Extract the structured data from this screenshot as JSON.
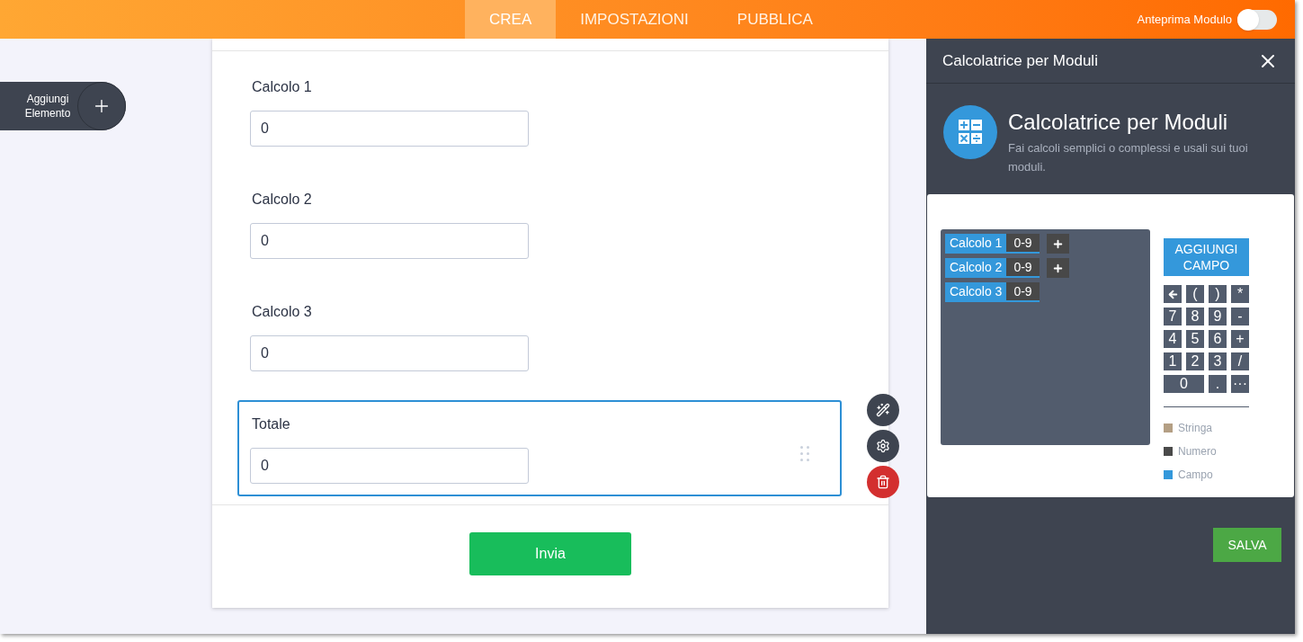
{
  "nav": {
    "tabs": [
      {
        "label": "CREA",
        "selected": true
      },
      {
        "label": "IMPOSTAZIONI",
        "selected": false
      },
      {
        "label": "PUBBLICA",
        "selected": false
      }
    ],
    "preview": {
      "label": "Anteprima Modulo",
      "on": false
    }
  },
  "add_element": {
    "label": "Aggiungi Elemento"
  },
  "form": {
    "fields": [
      {
        "label": "Calcolo 1",
        "value": "0",
        "selected": false
      },
      {
        "label": "Calcolo 2",
        "value": "0",
        "selected": false
      },
      {
        "label": "Calcolo 3",
        "value": "0",
        "selected": false
      },
      {
        "label": "Totale",
        "value": "0",
        "selected": true
      }
    ],
    "submit": "Invia"
  },
  "panel": {
    "title": "Calcolatrice per Moduli",
    "heading": "Calcolatrice per Moduli",
    "description": "Fai calcoli semplici o complessi e usali sui tuoi moduli.",
    "formula_fields": [
      {
        "name": "Calcolo 1",
        "type": "0-9",
        "plus": true
      },
      {
        "name": "Calcolo 2",
        "type": "0-9",
        "plus": true
      },
      {
        "name": "Calcolo 3",
        "type": "0-9",
        "plus": false
      }
    ],
    "add_field": "AGGIUNGI CAMPO",
    "keys": [
      {
        "kind": "backspace"
      },
      {
        "kind": "key",
        "label": "("
      },
      {
        "kind": "key",
        "label": ")"
      },
      {
        "kind": "key",
        "label": "*"
      },
      {
        "kind": "key",
        "label": "7"
      },
      {
        "kind": "key",
        "label": "8"
      },
      {
        "kind": "key",
        "label": "9"
      },
      {
        "kind": "key",
        "label": "-"
      },
      {
        "kind": "key",
        "label": "4"
      },
      {
        "kind": "key",
        "label": "5"
      },
      {
        "kind": "key",
        "label": "6"
      },
      {
        "kind": "key",
        "label": "+"
      },
      {
        "kind": "key",
        "label": "1"
      },
      {
        "kind": "key",
        "label": "2"
      },
      {
        "kind": "key",
        "label": "3"
      },
      {
        "kind": "key",
        "label": "/"
      },
      {
        "kind": "wide",
        "label": "0"
      },
      {
        "kind": "key",
        "label": "."
      },
      {
        "kind": "key",
        "label": "···"
      }
    ],
    "legend": [
      {
        "label": "Stringa",
        "color": "#b49f84"
      },
      {
        "label": "Numero",
        "color": "#4a4a4a"
      },
      {
        "label": "Campo",
        "color": "#3498db"
      }
    ],
    "save": "SALVA"
  }
}
